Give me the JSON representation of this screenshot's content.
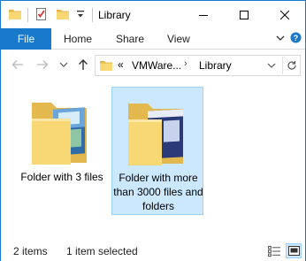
{
  "window": {
    "title": "Library"
  },
  "ribbon": {
    "tabs": [
      "File",
      "Home",
      "Share",
      "View"
    ]
  },
  "address": {
    "overflow": "«",
    "segments": [
      "VMWare...",
      "Library"
    ]
  },
  "items": [
    {
      "label": "Folder with 3 files",
      "selected": false
    },
    {
      "label": "Folder with more than 3000 files and folders",
      "selected": true
    }
  ],
  "status": {
    "count": "2 items",
    "selection": "1 item selected"
  },
  "colors": {
    "accent": "#1979ca",
    "selection_bg": "#cce8ff",
    "selection_border": "#99d1ff",
    "folder_yellow": "#f8d775"
  },
  "icons": [
    "folder-icon",
    "properties-icon",
    "new-folder-icon",
    "customize-arrow-icon",
    "minimize-icon",
    "maximize-icon",
    "close-icon",
    "chevron-down-icon",
    "help-icon",
    "back-arrow-icon",
    "forward-arrow-icon",
    "recent-dropdown-icon",
    "up-arrow-icon",
    "refresh-icon",
    "details-view-icon",
    "large-icons-view-icon"
  ]
}
